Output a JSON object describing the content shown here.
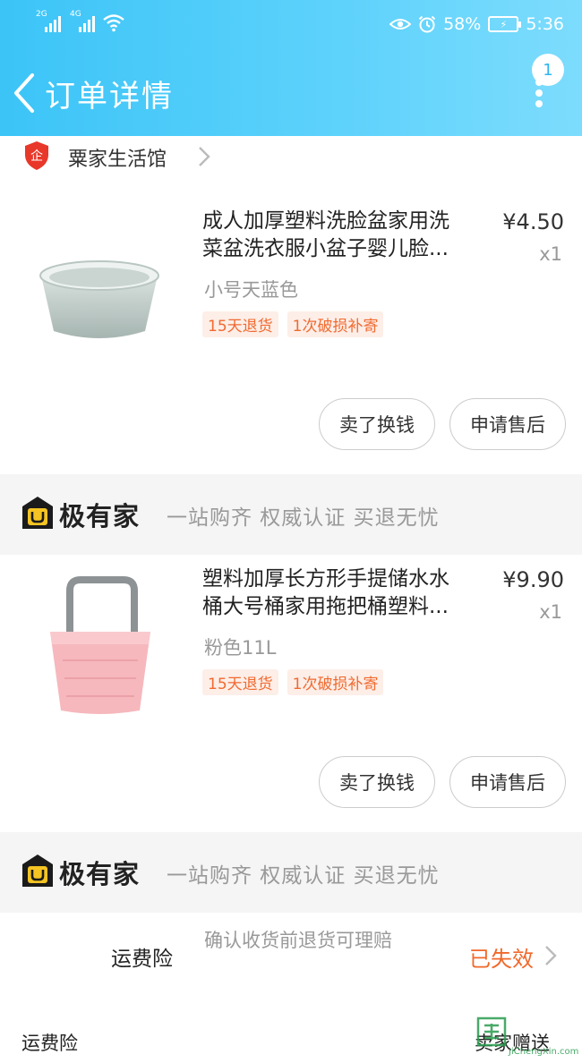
{
  "status_bar": {
    "sig1_label": "2G",
    "sig2_label": "4G",
    "battery_percent": "58%",
    "time": "5:36"
  },
  "header": {
    "title": "订单详情",
    "notification_count": "1"
  },
  "store": {
    "name": "粟家生活馆"
  },
  "orders": [
    {
      "title_line1": "成人加厚塑料洗脸盆家用洗",
      "title_line2": "菜盆洗衣服小盆子婴儿脸...",
      "price": "¥4.50",
      "qty": "x1",
      "variant": "小号天蓝色",
      "tags": [
        "15天退货",
        "1次破损补寄"
      ],
      "btn_sell": "卖了换钱",
      "btn_after_sale": "申请售后"
    },
    {
      "title_line1": "塑料加厚长方形手提储水水",
      "title_line2": "桶大号桶家用拖把桶塑料...",
      "price": "¥9.90",
      "qty": "x1",
      "variant": "粉色11L",
      "tags": [
        "15天退货",
        "1次破损补寄"
      ],
      "btn_sell": "卖了换钱",
      "btn_after_sale": "申请售后"
    }
  ],
  "banner": {
    "brand": "极有家",
    "slogan": "一站购齐 权威认证 买退无忧"
  },
  "insurance": {
    "label": "运费险",
    "desc": "确认收货前退货可理赔",
    "status": "已失效"
  },
  "bottom": {
    "label": "运费险",
    "value": "卖家赠送"
  },
  "watermark": {
    "text": "JiChengXin.com"
  },
  "colors": {
    "header_start": "#3cc4f7",
    "header_end": "#7ddcfd",
    "accent_orange": "#f0682a",
    "tag_bg": "#fdeee8"
  }
}
